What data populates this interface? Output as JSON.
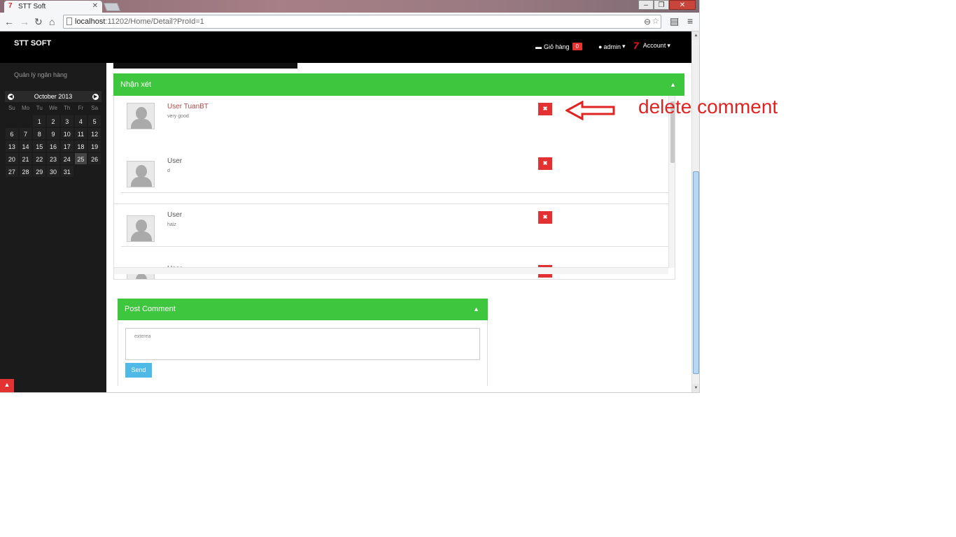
{
  "browser": {
    "tab_title": "STT Soft",
    "tab_favicon": "7",
    "url_host": "localhost",
    "url_rest": ":11202/Home/Detail?ProId=1",
    "window_buttons": [
      "–",
      "❐",
      "✕"
    ]
  },
  "navbar": {
    "brand": "STT SOFT",
    "cart_label": "Giỏ hàng",
    "cart_count": "0",
    "user_label": "admin",
    "account_label": "Account"
  },
  "sidebar": {
    "title": "Quản lý ngân hàng",
    "calendar": {
      "month": "October 2013",
      "weekdays": [
        "Su",
        "Mo",
        "Tu",
        "We",
        "Th",
        "Fr",
        "Sa"
      ],
      "days": [
        [
          "",
          "",
          "1",
          "2",
          "3",
          "4",
          "5"
        ],
        [
          "6",
          "7",
          "8",
          "9",
          "10",
          "11",
          "12"
        ],
        [
          "13",
          "14",
          "15",
          "16",
          "17",
          "18",
          "19"
        ],
        [
          "20",
          "21",
          "22",
          "23",
          "24",
          "25",
          "26"
        ],
        [
          "27",
          "28",
          "29",
          "30",
          "31",
          "",
          ""
        ]
      ],
      "today": "25"
    }
  },
  "comments_panel": {
    "title": "Nhận xét",
    "items": [
      {
        "user": "User TuanBT",
        "text": "very good"
      },
      {
        "user": "User",
        "text": "d"
      },
      {
        "user": "User",
        "text": "haiz"
      },
      {
        "user": "User",
        "text": ""
      }
    ],
    "delete_icon": "✖"
  },
  "post_panel": {
    "title": "Post Comment",
    "textarea_value": "exterea",
    "send_label": "Send"
  },
  "annotation": {
    "text": "delete comment",
    "color": "#e02323"
  },
  "colors": {
    "panel_green": "#3fc63f",
    "delete_red": "#e33030",
    "send_blue": "#4fb9e8"
  }
}
